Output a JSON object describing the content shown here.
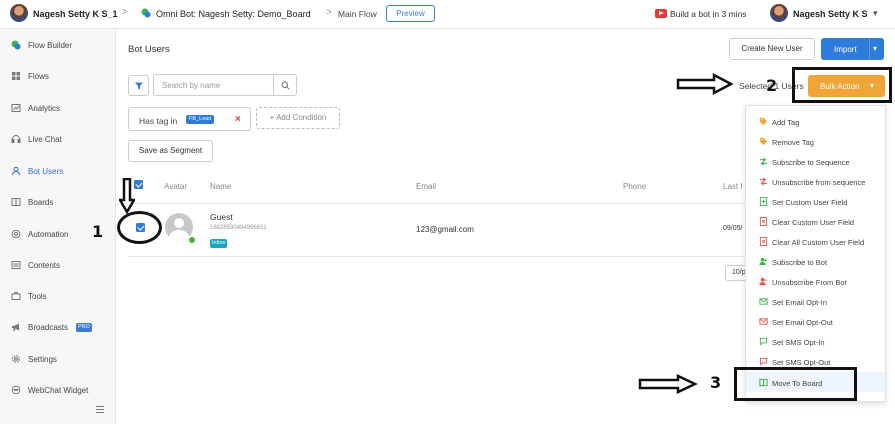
{
  "topbar": {
    "user_name": "Nagesh Setty K S_1",
    "separator": ">",
    "bot_title": "Omni Bot: Nagesh Setty: Demo_Board",
    "separator2": ">",
    "flow": "Main Flow",
    "preview_label": "Preview",
    "build_bot_label": "Build a bot in 3 mins",
    "account_name": "Nagesh Setty K S"
  },
  "sidebar": {
    "items": [
      {
        "label": "Flow Builder",
        "icon": "flow-builder-icon"
      },
      {
        "label": "Flows",
        "icon": "grid-icon"
      },
      {
        "label": "Analytics",
        "icon": "analytics-icon"
      },
      {
        "label": "Live Chat",
        "icon": "headset-icon"
      },
      {
        "label": "Bot Users",
        "icon": "user-icon",
        "active": true
      },
      {
        "label": "Boards",
        "icon": "board-icon"
      },
      {
        "label": "Automation",
        "icon": "automation-icon"
      },
      {
        "label": "Contents",
        "icon": "contents-icon"
      },
      {
        "label": "Tools",
        "icon": "tools-icon"
      },
      {
        "label": "Broadcasts",
        "icon": "megaphone-icon",
        "badge": "PRO"
      },
      {
        "label": "Settings",
        "icon": "gear-icon"
      },
      {
        "label": "WebChat Widget",
        "icon": "chat-widget-icon"
      }
    ]
  },
  "main": {
    "title": "Bot Users",
    "create_button": "Create New User",
    "import_button": "Import",
    "search_placeholder": "Search by name",
    "selected_text": "Selected 1 Users",
    "bulk_action_label": "Bulk Action",
    "condition": {
      "text": "Has tag in",
      "tag": "FB_Lead"
    },
    "add_condition": "+ Add Condition",
    "save_segment": "Save as Segment",
    "columns": [
      "Avatar",
      "Name",
      "Email",
      "Phone",
      "Last I"
    ],
    "user": {
      "name": "Guest",
      "id": "16828590494996631",
      "badge": "Inbox",
      "email": "123@gmail.com",
      "last": "09/05/"
    },
    "pager": "10/p"
  },
  "bulk_menu": {
    "items": [
      {
        "label": "Add Tag",
        "icon": "tag-icon",
        "color": "#f0a538"
      },
      {
        "label": "Remove Tag",
        "icon": "tag-remove-icon",
        "color": "#f0a538"
      },
      {
        "label": "Subscribe to Sequence",
        "icon": "sequence-icon",
        "color": "#3bb54a"
      },
      {
        "label": "Unsubscribe from sequence",
        "icon": "sequence-off-icon",
        "color": "#e5534b"
      },
      {
        "label": "Set Custom User Field",
        "icon": "doc-plus-icon",
        "color": "#3bb54a"
      },
      {
        "label": "Clear Custom User Field",
        "icon": "doc-x-icon",
        "color": "#e5534b"
      },
      {
        "label": "Clear All Custom User Field",
        "icon": "doc-x-icon",
        "color": "#e5534b"
      },
      {
        "label": "Subscribe to Bot",
        "icon": "user-plus-icon",
        "color": "#3bb54a"
      },
      {
        "label": "Unsubscribe From Bot",
        "icon": "user-minus-icon",
        "color": "#e5534b"
      },
      {
        "label": "Set Email Opt-In",
        "icon": "email-in-icon",
        "color": "#3bb54a"
      },
      {
        "label": "Set Email Opt-Out",
        "icon": "email-out-icon",
        "color": "#e5534b"
      },
      {
        "label": "Set SMS Opt-In",
        "icon": "sms-in-icon",
        "color": "#3bb54a"
      },
      {
        "label": "Set SMS Opt-Out",
        "icon": "sms-out-icon",
        "color": "#e5534b"
      },
      {
        "label": "Move To Board",
        "icon": "board-move-icon",
        "color": "#3bb54a"
      }
    ]
  },
  "annotations": {
    "step1": "1",
    "step2": "2",
    "step3": "3"
  }
}
